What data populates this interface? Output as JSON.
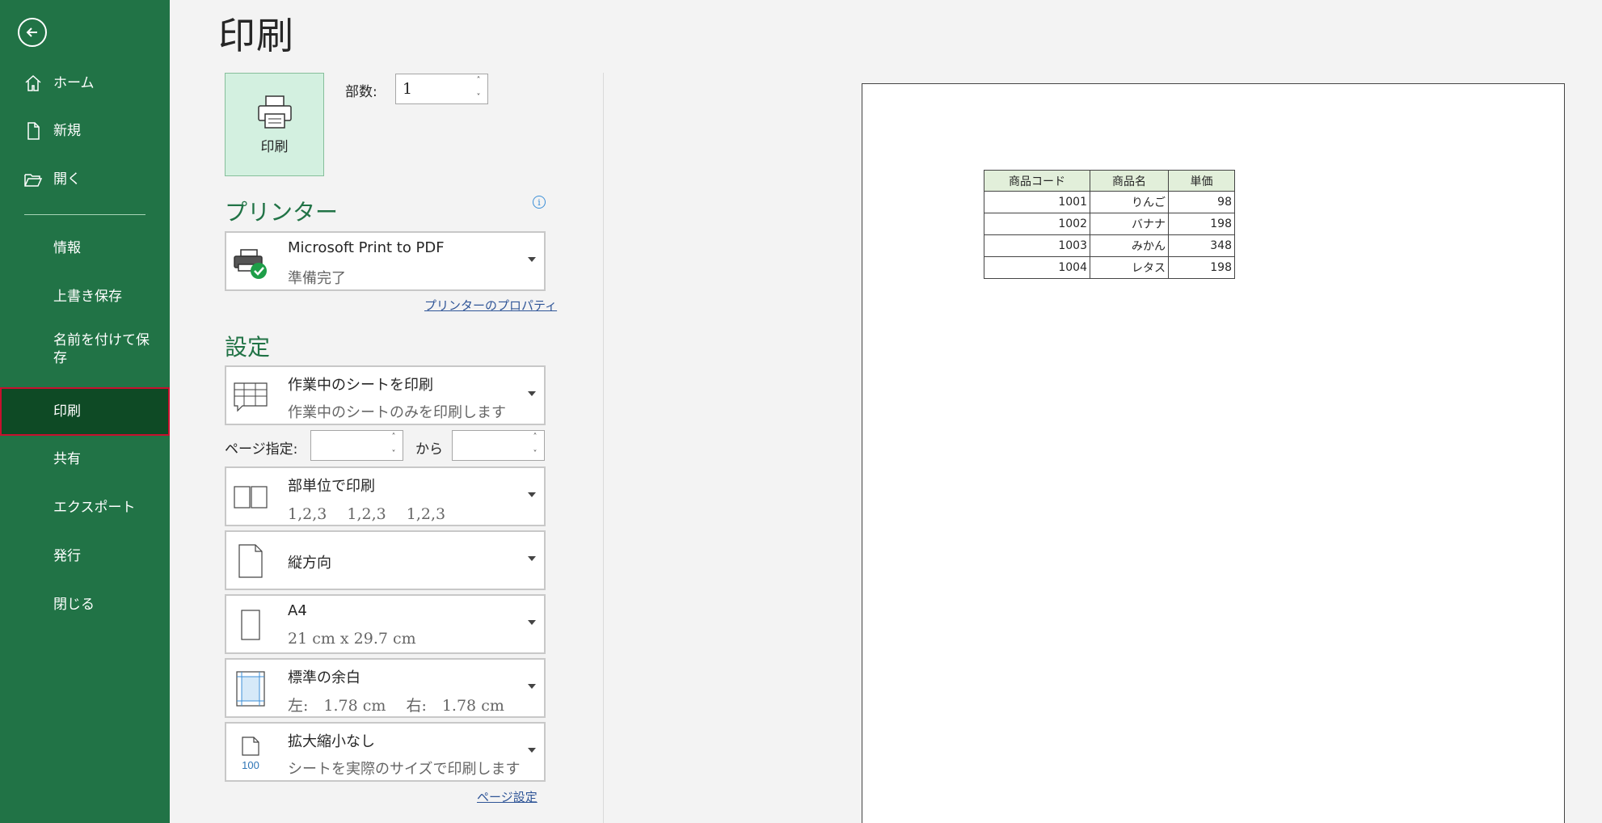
{
  "sidebar": {
    "items": [
      {
        "label": "ホーム"
      },
      {
        "label": "新規"
      },
      {
        "label": "開く"
      },
      {
        "label": "情報"
      },
      {
        "label": "上書き保存"
      },
      {
        "label": "名前を付けて保\n存"
      },
      {
        "label": "印刷"
      },
      {
        "label": "共有"
      },
      {
        "label": "エクスポート"
      },
      {
        "label": "発行"
      },
      {
        "label": "閉じる"
      }
    ]
  },
  "main": {
    "title": "印刷",
    "print_button_label": "印刷",
    "copies_label": "部数:",
    "copies_value": "1",
    "printer_section_title": "プリンター",
    "printer": {
      "name": "Microsoft Print to PDF",
      "status": "準備完了"
    },
    "printer_properties_link": "プリンターのプロパティ",
    "settings_section_title": "設定",
    "settings": [
      {
        "main": "作業中のシートを印刷",
        "sub": "作業中のシートのみを印刷します"
      },
      {
        "main": "部単位で印刷",
        "sub": "1,2,3　 1,2,3　 1,2,3"
      },
      {
        "main": "縦方向",
        "sub": ""
      },
      {
        "main": "A4",
        "sub": "21 cm x 29.7 cm"
      },
      {
        "main": "標準の余白",
        "sub": "左:　1.78 cm　 右:　1.78 cm"
      },
      {
        "main": "拡大縮小なし",
        "sub": "シートを実際のサイズで印刷します"
      }
    ],
    "page_range_label": "ページ指定:",
    "page_range_to_label": "から",
    "page_range_from_value": "",
    "page_range_to_value": "",
    "page_setup_link": "ページ設定"
  },
  "preview": {
    "headers": [
      "商品コード",
      "商品名",
      "単価"
    ],
    "rows": [
      [
        "1001",
        "りんご",
        "98"
      ],
      [
        "1002",
        "バナナ",
        "198"
      ],
      [
        "1003",
        "みかん",
        "348"
      ],
      [
        "1004",
        "レタス",
        "198"
      ]
    ]
  },
  "colors": {
    "sidebar": "#217346",
    "sidebar_active": "#0e4a25",
    "active_border": "#c8102e",
    "accent": "#217346",
    "print_button_bg": "#d3f0e0",
    "table_header_bg": "#e2efda"
  },
  "icons": [
    "back-arrow-icon",
    "home-icon",
    "new-file-icon",
    "open-folder-icon",
    "printer-icon",
    "printer-ready-icon",
    "info-icon",
    "sheet-grid-icon",
    "collate-icon",
    "portrait-icon",
    "paper-size-icon",
    "margins-icon",
    "no-scaling-icon",
    "dropdown-arrow-icon"
  ]
}
